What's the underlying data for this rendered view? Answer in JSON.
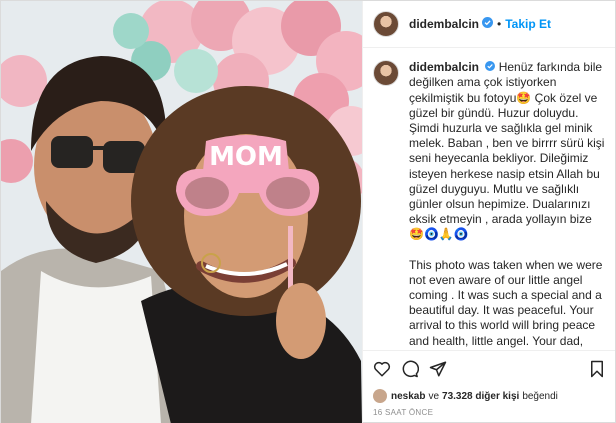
{
  "header": {
    "username": "didembalcin",
    "separator": "•",
    "follow_label": "Takip Et"
  },
  "caption": {
    "username": "didembalcin",
    "paragraph_tr": "Henüz farkında bile değilken ama çok istiyorken çekilmiştik bu fotoyu🤩 Çok özel ve güzel bir gündü. Huzur doluydu. Şimdi huzurla ve sağlıkla gel minik melek. Baban , ben ve birrrr sürü kişi seni heyecanla bekliyor. Dileğimiz isteyen herkese nasip etsin Allah bu güzel duyguyu. Mutlu ve sağlıklı günler olsun hepimize. Dualarınızı eksik etmeyin , arada yollayın bize🤩🧿🙏🧿",
    "paragraph_en": "This photo was taken when we were not even aware of our little angel coming . It was such a special and a beautiful day. It was peaceful. Your arrival to this world will bring peace and health, little angel. Your dad, me, and many other people are looking forward to meeting you. May Allah"
  },
  "photo": {
    "prop_text": "MOM"
  },
  "actions": {
    "like_icon": "heart-icon",
    "comment_icon": "comment-icon",
    "share_icon": "share-icon",
    "save_icon": "bookmark-icon"
  },
  "likes": {
    "first_user": "neskab",
    "middle": "ve",
    "count": "73.328 diğer kişi",
    "suffix": "beğendi"
  },
  "timestamp": "16 SAAT ÖNCE",
  "colors": {
    "accent": "#0095f6",
    "verified": "#3897f0",
    "text": "#262626",
    "muted": "#8e8e8e"
  }
}
